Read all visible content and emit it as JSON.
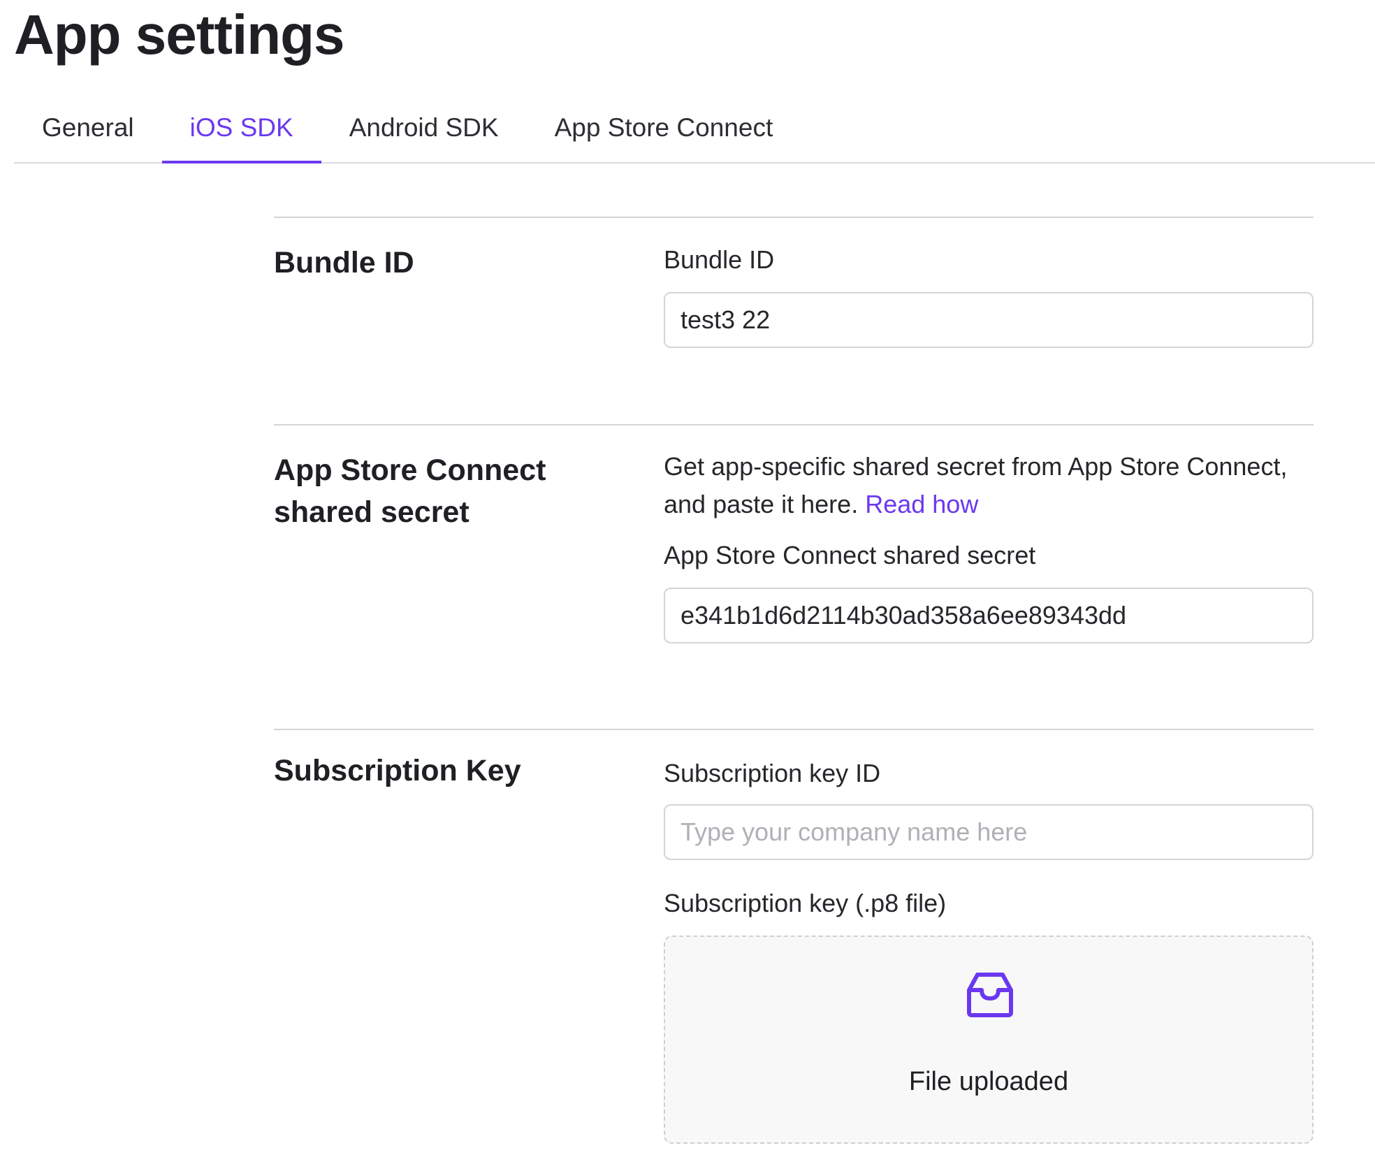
{
  "page": {
    "title": "App settings"
  },
  "tabs": [
    {
      "label": "General",
      "active": false
    },
    {
      "label": "iOS SDK",
      "active": true
    },
    {
      "label": "Android SDK",
      "active": false
    },
    {
      "label": "App Store Connect",
      "active": false
    }
  ],
  "bundle_section": {
    "title": "Bundle ID",
    "field_label": "Bundle ID",
    "field_value": "test3 22"
  },
  "shared_secret_section": {
    "title": "App Store Connect shared secret",
    "help_text": "Get app-specific shared secret from App Store Connect, and paste it here.",
    "help_link": "Read how",
    "field_label": "App Store Connect shared secret",
    "field_value": "e341b1d6d2114b30ad358a6ee89343dd"
  },
  "subscription_section": {
    "title": "Subscription Key",
    "key_id_label": "Subscription key ID",
    "key_id_value": "",
    "key_id_placeholder": "Type your company name here",
    "file_label": "Subscription key (.p8 file)",
    "file_status": "File uploaded"
  },
  "colors": {
    "accent": "#6b38f0",
    "text": "#1f1f24",
    "border": "#d4d4d8",
    "dropzone_bg": "#f8f8f9"
  },
  "icons": {
    "dropzone": "inbox-icon"
  }
}
